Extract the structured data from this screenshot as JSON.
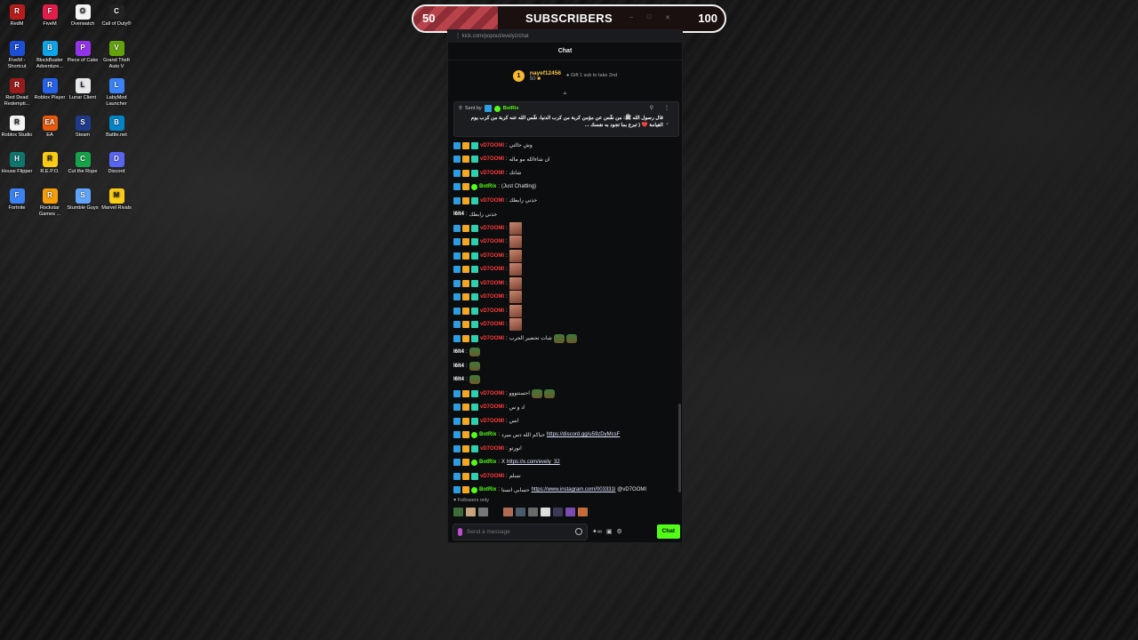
{
  "desktop": {
    "icons": [
      {
        "label": "RedM",
        "color": "#b91c1c",
        "glyph": "R",
        "col": 0,
        "row": 0
      },
      {
        "label": "FiveM",
        "color": "#e11d48",
        "glyph": "F",
        "col": 1,
        "row": 0
      },
      {
        "label": "Overwatch",
        "color": "#f5f5f5",
        "glyph": "O",
        "col": 2,
        "row": 0
      },
      {
        "label": "Call of Duty®",
        "color": "#222222",
        "glyph": "C",
        "col": 3,
        "row": 0
      },
      {
        "label": "FiveM - Shortcut",
        "color": "#1d4ed8",
        "glyph": "F",
        "col": 0,
        "row": 1
      },
      {
        "label": "BlockBuster Adventure...",
        "color": "#0ea5e9",
        "glyph": "B",
        "col": 1,
        "row": 1
      },
      {
        "label": "Piece of Cake",
        "color": "#9333ea",
        "glyph": "P",
        "col": 2,
        "row": 1
      },
      {
        "label": "Grand Theft Auto V",
        "color": "#65a30d",
        "glyph": "V",
        "col": 3,
        "row": 1
      },
      {
        "label": "Red Dead Redempti...",
        "color": "#991b1b",
        "glyph": "R",
        "col": 0,
        "row": 2
      },
      {
        "label": "Roblox Player",
        "color": "#2563eb",
        "glyph": "R",
        "col": 1,
        "row": 2
      },
      {
        "label": "Lunar Client",
        "color": "#e5e7eb",
        "glyph": "L",
        "col": 2,
        "row": 2
      },
      {
        "label": "LabyMod Launcher",
        "color": "#3b82f6",
        "glyph": "L",
        "col": 3,
        "row": 2
      },
      {
        "label": "Roblox Studio",
        "color": "#f5f5f5",
        "glyph": "R",
        "col": 0,
        "row": 3
      },
      {
        "label": "EA",
        "color": "#ea580c",
        "glyph": "EA",
        "col": 1,
        "row": 3
      },
      {
        "label": "Steam",
        "color": "#1e3a8a",
        "glyph": "S",
        "col": 2,
        "row": 3
      },
      {
        "label": "Battle.net",
        "color": "#0284c7",
        "glyph": "B",
        "col": 3,
        "row": 3
      },
      {
        "label": "House Flipper",
        "color": "#0f766e",
        "glyph": "H",
        "col": 0,
        "row": 4
      },
      {
        "label": "R.E.P.O.",
        "color": "#facc15",
        "glyph": "R",
        "col": 1,
        "row": 4
      },
      {
        "label": "Cut the Rope",
        "color": "#16a34a",
        "glyph": "C",
        "col": 2,
        "row": 4
      },
      {
        "label": "Discord",
        "color": "#5865f2",
        "glyph": "D",
        "col": 3,
        "row": 4
      },
      {
        "label": "Fortnite",
        "color": "#3b82f6",
        "glyph": "F",
        "col": 0,
        "row": 5
      },
      {
        "label": "Rockstar Games ...",
        "color": "#f59e0b",
        "glyph": "R",
        "col": 1,
        "row": 5
      },
      {
        "label": "Stumble Guys",
        "color": "#60a5fa",
        "glyph": "S",
        "col": 2,
        "row": 5
      },
      {
        "label": "Marvel Rivals",
        "color": "#facc15",
        "glyph": "M",
        "col": 3,
        "row": 5
      }
    ]
  },
  "subscribers": {
    "current": "50",
    "title": "SUBSCRIBERS",
    "goal": "100",
    "progress_fraction": 0.27
  },
  "chat": {
    "url": "kick.com/popout/evelyz/chat",
    "title": "Chat",
    "leader": {
      "rank": "1",
      "name": "nayef12456",
      "count": "50",
      "gift_text": "Gift 1 sub to take 2nd"
    },
    "pinned": {
      "sent_by_label": "Sent by",
      "sender": "BotRix",
      "text": "قال رسول الله ﷺ: من نفّس عن مؤمن كربة من كرب الدنيا، نفّس الله عنه كربة من كرب يوم القيامة ❤️ ( تبرع بما تجود به نفسك ..."
    },
    "messages": [
      {
        "user": "vD7OOMI",
        "kind": "red",
        "text": "وش حالتي",
        "badges": true
      },
      {
        "user": "vD7OOMI",
        "kind": "red",
        "text": "ان شاءالله مو ماله",
        "badges": true
      },
      {
        "user": "vD7OOMI",
        "kind": "red",
        "text": "شاتك",
        "badges": true
      },
      {
        "user": "BotRix",
        "kind": "bot",
        "text": "(Just Chatting)",
        "badges": true
      },
      {
        "user": "vD7OOMI",
        "kind": "red",
        "text": "خذني رابطك",
        "badges": true
      },
      {
        "user": "l6lt4",
        "kind": "plain",
        "text": "خذني رابطك",
        "badges": false
      },
      {
        "user": "vD7OOMI",
        "kind": "red",
        "emote": "img",
        "badges": true
      },
      {
        "user": "vD7OOMI",
        "kind": "red",
        "emote": "img",
        "badges": true
      },
      {
        "user": "vD7OOMI",
        "kind": "red",
        "emote": "img",
        "badges": true
      },
      {
        "user": "vD7OOMI",
        "kind": "red",
        "emote": "img",
        "badges": true
      },
      {
        "user": "vD7OOMI",
        "kind": "red",
        "emote": "img",
        "badges": true
      },
      {
        "user": "vD7OOMI",
        "kind": "red",
        "emote": "img",
        "badges": true
      },
      {
        "user": "vD7OOMI",
        "kind": "red",
        "emote": "img",
        "badges": true
      },
      {
        "user": "vD7OOMI",
        "kind": "red",
        "emote": "img",
        "badges": true
      },
      {
        "user": "vD7OOMI",
        "kind": "red",
        "text": "شات تحضير الحرب",
        "emote": "frog2",
        "badges": true
      },
      {
        "user": "l6lt4",
        "kind": "plain",
        "emote": "frog",
        "badges": false
      },
      {
        "user": "l6lt4",
        "kind": "plain",
        "emote": "frog",
        "badges": false
      },
      {
        "user": "l6lt4",
        "kind": "plain",
        "emote": "frog",
        "badges": false
      },
      {
        "user": "vD7OOMI",
        "kind": "red",
        "text": "احسنتووو",
        "emote": "frog2",
        "badges": true
      },
      {
        "user": "vD7OOMI",
        "kind": "red",
        "text": "د و س!",
        "badges": true
      },
      {
        "user": "vD7OOMI",
        "kind": "red",
        "text": "نس!",
        "badges": true
      },
      {
        "user": "BotRix",
        "kind": "bot",
        "text": "حياكم الله دس ميرد",
        "link": "https://discord.gg/u59zDyMcsF",
        "badges": true
      },
      {
        "user": "vD7OOMI",
        "kind": "red",
        "text": "نورتو!",
        "badges": true
      },
      {
        "user": "BotRix",
        "kind": "bot",
        "text": "X",
        "link": "https://x.com/evely_32",
        "badges": true
      },
      {
        "user": "vD7OOMI",
        "kind": "red",
        "text": "تسلم",
        "badges": true
      },
      {
        "user": "BotRix",
        "kind": "bot",
        "text": "حسابي انستا",
        "link": "https://www.instagram.com/003331l",
        "suffix": "@vD7OOMI",
        "badges": true
      }
    ],
    "followers_only": "Followers only",
    "input_placeholder": "Send a message",
    "send_label": "Chat"
  }
}
